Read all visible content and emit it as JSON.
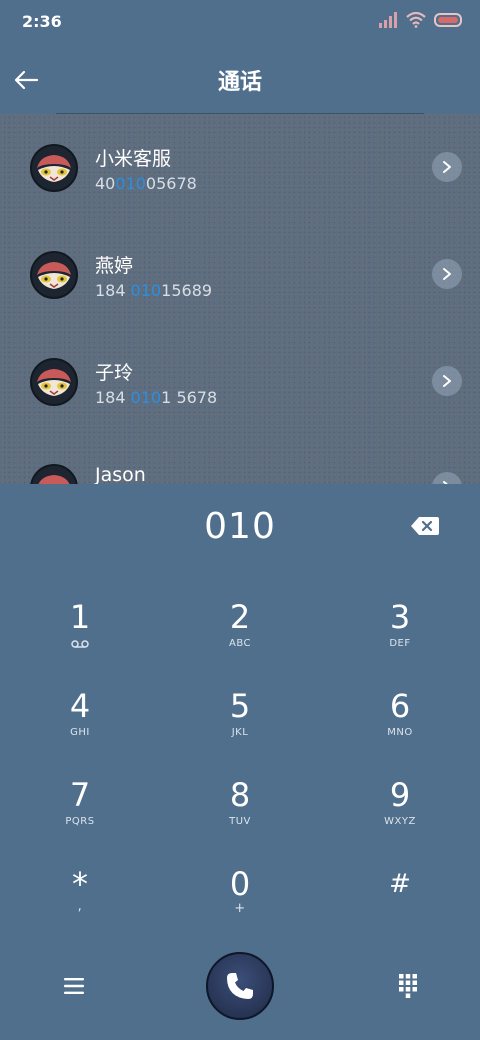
{
  "status_bar": {
    "time": "2:36",
    "icons": [
      "signal-icon",
      "wifi-icon",
      "battery-icon"
    ]
  },
  "app_bar": {
    "title": "通话",
    "back_icon": "arrow-left-icon"
  },
  "query": "010",
  "contacts": [
    {
      "name": "小米客服",
      "number_pre": "40",
      "number_match": "010",
      "number_post": "05678"
    },
    {
      "name": "燕婷",
      "number_pre": "184 ",
      "number_match": "010",
      "number_post": "15689"
    },
    {
      "name": "子玲",
      "number_pre": "184 ",
      "number_match": "010",
      "number_post": "1 5678"
    },
    {
      "name": "Jason",
      "number_pre": "",
      "number_match": "",
      "number_post": ""
    }
  ],
  "dialer": {
    "display": "010",
    "backspace_icon": "backspace-icon",
    "keys": [
      {
        "digit": "1",
        "sub": "voicemail-icon"
      },
      {
        "digit": "2",
        "sub": "ABC"
      },
      {
        "digit": "3",
        "sub": "DEF"
      },
      {
        "digit": "4",
        "sub": "GHI"
      },
      {
        "digit": "5",
        "sub": "JKL"
      },
      {
        "digit": "6",
        "sub": "MNO"
      },
      {
        "digit": "7",
        "sub": "PQRS"
      },
      {
        "digit": "8",
        "sub": "TUV"
      },
      {
        "digit": "9",
        "sub": "WXYZ"
      },
      {
        "digit": "*",
        "sub": ","
      },
      {
        "digit": "0",
        "sub": "+"
      },
      {
        "digit": "#",
        "sub": ""
      }
    ]
  },
  "bottom_bar": {
    "menu_icon": "menu-icon",
    "call_icon": "phone-icon",
    "keypad_icon": "dialpad-icon"
  },
  "colors": {
    "background": "#4f6f8c",
    "highlight": "#2b8fe0",
    "battery": "#d86a6a"
  }
}
